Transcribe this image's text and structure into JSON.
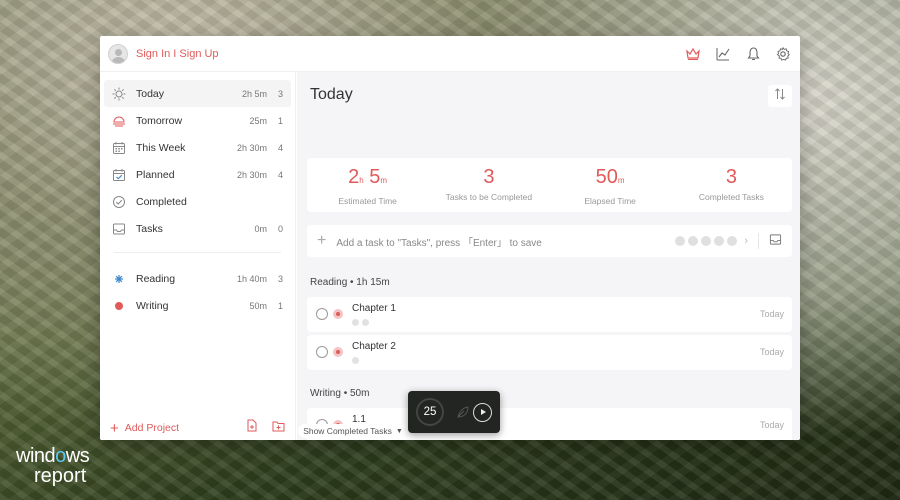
{
  "watermark": {
    "line1_a": "wind",
    "line1_b": "o",
    "line1_c": "ws",
    "line2": "report"
  },
  "header": {
    "signin_label": "Sign In I Sign Up"
  },
  "sidebar": {
    "items": [
      {
        "label": "Today",
        "time": "2h 5m",
        "count": "3",
        "icon": "sun-icon"
      },
      {
        "label": "Tomorrow",
        "time": "25m",
        "count": "1",
        "icon": "sunrise-icon"
      },
      {
        "label": "This Week",
        "time": "2h 30m",
        "count": "4",
        "icon": "calendar-icon"
      },
      {
        "label": "Planned",
        "time": "2h 30m",
        "count": "4",
        "icon": "calendar-check-icon"
      },
      {
        "label": "Completed",
        "time": "",
        "count": "",
        "icon": "check-circle-icon"
      },
      {
        "label": "Tasks",
        "time": "0m",
        "count": "0",
        "icon": "inbox-icon"
      }
    ],
    "projects": [
      {
        "label": "Reading",
        "time": "1h 40m",
        "count": "3",
        "color": "#3a86c8"
      },
      {
        "label": "Writing",
        "time": "50m",
        "count": "1",
        "color": "#e05a5a"
      }
    ],
    "add_project_label": "Add Project"
  },
  "main": {
    "title": "Today",
    "stats": [
      {
        "h": "2",
        "h_unit": "h",
        "m": "5",
        "m_unit": "m",
        "caption": "Estimated Time"
      },
      {
        "value": "3",
        "caption": "Tasks to be Completed"
      },
      {
        "m": "50",
        "m_unit": "m",
        "caption": "Elapsed Time"
      },
      {
        "value": "3",
        "caption": "Completed Tasks"
      }
    ],
    "add_task_placeholder": "Add a task to \"Tasks\", press 「Enter」 to save",
    "groups": [
      {
        "header": "Reading  •  1h 15m",
        "tasks": [
          {
            "name": "Chapter 1",
            "date": "Today"
          },
          {
            "name": "Chapter 2",
            "date": "Today"
          }
        ]
      },
      {
        "header": "Writing  •  50m",
        "tasks": [
          {
            "name": "1.1",
            "date": "Today"
          }
        ]
      }
    ],
    "show_completed_label": "Show Completed Tasks"
  },
  "timer": {
    "minutes": "25"
  },
  "colors": {
    "accent": "#e05a5a",
    "project_reading": "#3a86c8"
  }
}
